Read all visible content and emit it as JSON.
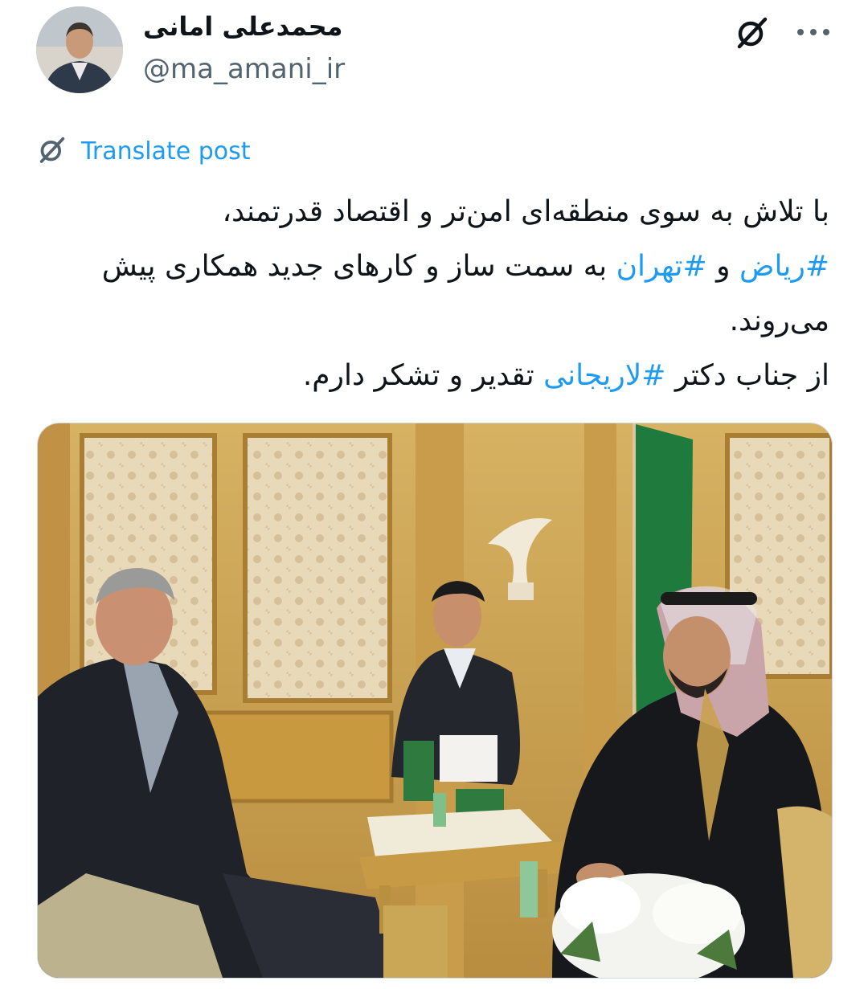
{
  "author": {
    "display_name": "محمدعلی امانی",
    "handle": "@ma_amani_ir",
    "avatar_icon": "user-avatar"
  },
  "actions": {
    "grok_icon": "grok-icon",
    "more_icon": "more-icon"
  },
  "translate": {
    "label": "Translate post",
    "icon": "grok-icon"
  },
  "post": {
    "line1": "با تلاش به سوی منطقه‌ای امن‌تر و اقتصاد قدرتمند،",
    "line2_tag1": "#ریاض",
    "line2_and": " و ",
    "line2_tag2": "#تهران",
    "line2_rest": " به سمت ساز و کارهای جدید همکاری پیش می‌روند.",
    "line3_start": "از جناب دکتر ",
    "line3_tag": "#لاریجانی",
    "line3_rest": " تقدیر و تشکر دارم."
  },
  "media": {
    "type": "photo"
  },
  "colors": {
    "accent": "#1d9bf0",
    "text": "#0f1419",
    "secondary": "#536471"
  }
}
